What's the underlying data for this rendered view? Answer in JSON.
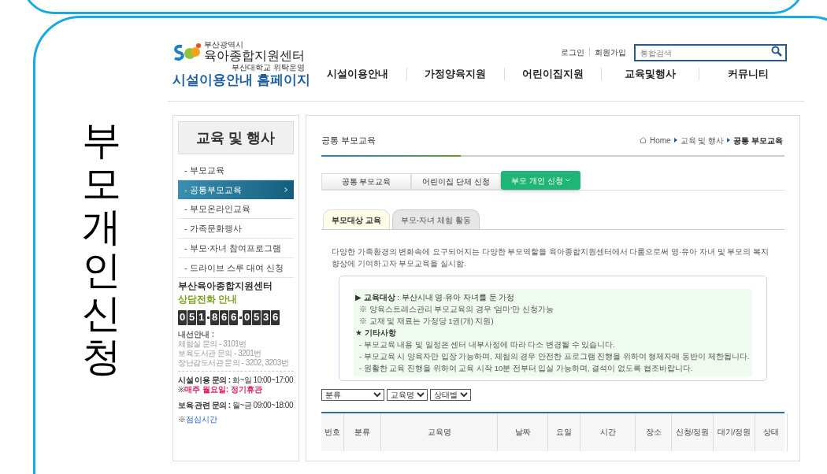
{
  "slide_title": "부모 개인 신청",
  "header": {
    "logo": {
      "city": "부산광역시",
      "name": "육아종합지원센터",
      "operator": "부산대학교 위탁운영",
      "site": "시설이용안내 홈페이지"
    },
    "util_links": [
      "로그인",
      "회원가입"
    ],
    "search": {
      "placeholder": "통합검색"
    },
    "nav": [
      "시설이용안내",
      "가정양육지원",
      "어린이집지원",
      "교육및행사",
      "커뮤니티"
    ]
  },
  "sidebar": {
    "title": "교육 및 행사",
    "items": [
      {
        "label": "- 부모교육",
        "selected": false
      },
      {
        "label": "- 공통부모교육",
        "selected": true
      },
      {
        "label": "- 부모온라인교육",
        "selected": false
      },
      {
        "label": "- 가족문화행사",
        "selected": false
      },
      {
        "label": "- 부모·자녀 참여프로그램",
        "selected": false
      },
      {
        "label": "- 드라이브 스루 대여 신청",
        "selected": false
      }
    ],
    "contact": {
      "center": "부산육아종합지원센터",
      "subtitle": "상담전화 안내",
      "phone_groups": [
        [
          "0",
          "5",
          "1"
        ],
        [
          "8",
          "6",
          "6"
        ],
        [
          "0",
          "5",
          "3",
          "6"
        ]
      ],
      "extension_label": "내선안내 :",
      "extensions": [
        "체험실 문의 - 3101번",
        "보육도서관 문의 - 3201번",
        "장난감도서관 문의 - 3202, 3203번"
      ],
      "hours": [
        {
          "label": "시설 이용 문의 :",
          "value": "화~일 10:00~17:00"
        }
      ],
      "closed_mark": "※",
      "closed_notice": "매주 월요일: 정기휴관",
      "care": {
        "label": "보육 관련 문의 :",
        "value": "월~금 09:00~18:00"
      },
      "lunch_mark": "※",
      "lunch_link": "점심시간"
    }
  },
  "content": {
    "page_title": "공통 부모교육",
    "breadcrumb": [
      "Home",
      "교육 및 행사",
      "공통 부모교육"
    ],
    "tabs": [
      {
        "label": "공통 부모교육",
        "selected": false
      },
      {
        "label": "어린이집 단체 신청",
        "selected": false
      },
      {
        "label": "부모 개인 신청",
        "selected": true
      }
    ],
    "subtabs": [
      {
        "label": "부모대상 교육",
        "selected": true
      },
      {
        "label": "부모-자녀 체험 활동",
        "selected": false
      }
    ],
    "intro": "다양한 가족환경의 변화속에 요구되어지는 다양한 부모역할을 육아종합지원센터에서 다룸으로써 영·유아 자녀 및 부모의 복지향상에 기여하고자 부모교육을 실시함.",
    "info": [
      {
        "kind": "heading",
        "text": "▶ **교육대상** : 부산시내 영·유아 자녀를 둔 가정"
      },
      {
        "kind": "note",
        "text": "※ 양육스트레스관리 부모교육의 경우 '엄마'만 신청가능"
      },
      {
        "kind": "note",
        "text": "※ 교재 및 재료는 가정당 1권(개) 지원)"
      },
      {
        "kind": "heading",
        "text": "★ **기타사항**"
      },
      {
        "kind": "note",
        "text": "- 부모교육 내용 및 일정은 센터 내부사정에 따라 다소 변경될 수 있습니다."
      },
      {
        "kind": "note",
        "text": "- 부모교육 시 양육자만 입장 가능하며, 체험의 경우 안전한 프로그램 진행을 위하여 형제자매 동반이 제한됩니다."
      },
      {
        "kind": "note",
        "text": "- 원활한 교육 진행을 위하여 교육 시작 10분 전부터 입실 가능하며, 결석이 없도록 협조바랍니다."
      }
    ],
    "filters": [
      "분류",
      "교육명",
      "상태별"
    ],
    "table": {
      "columns": [
        "번호",
        "분류",
        "교육명",
        "날짜",
        "요일",
        "시간",
        "장소",
        "신청/정원",
        "대기/정원",
        "상태"
      ]
    }
  }
}
